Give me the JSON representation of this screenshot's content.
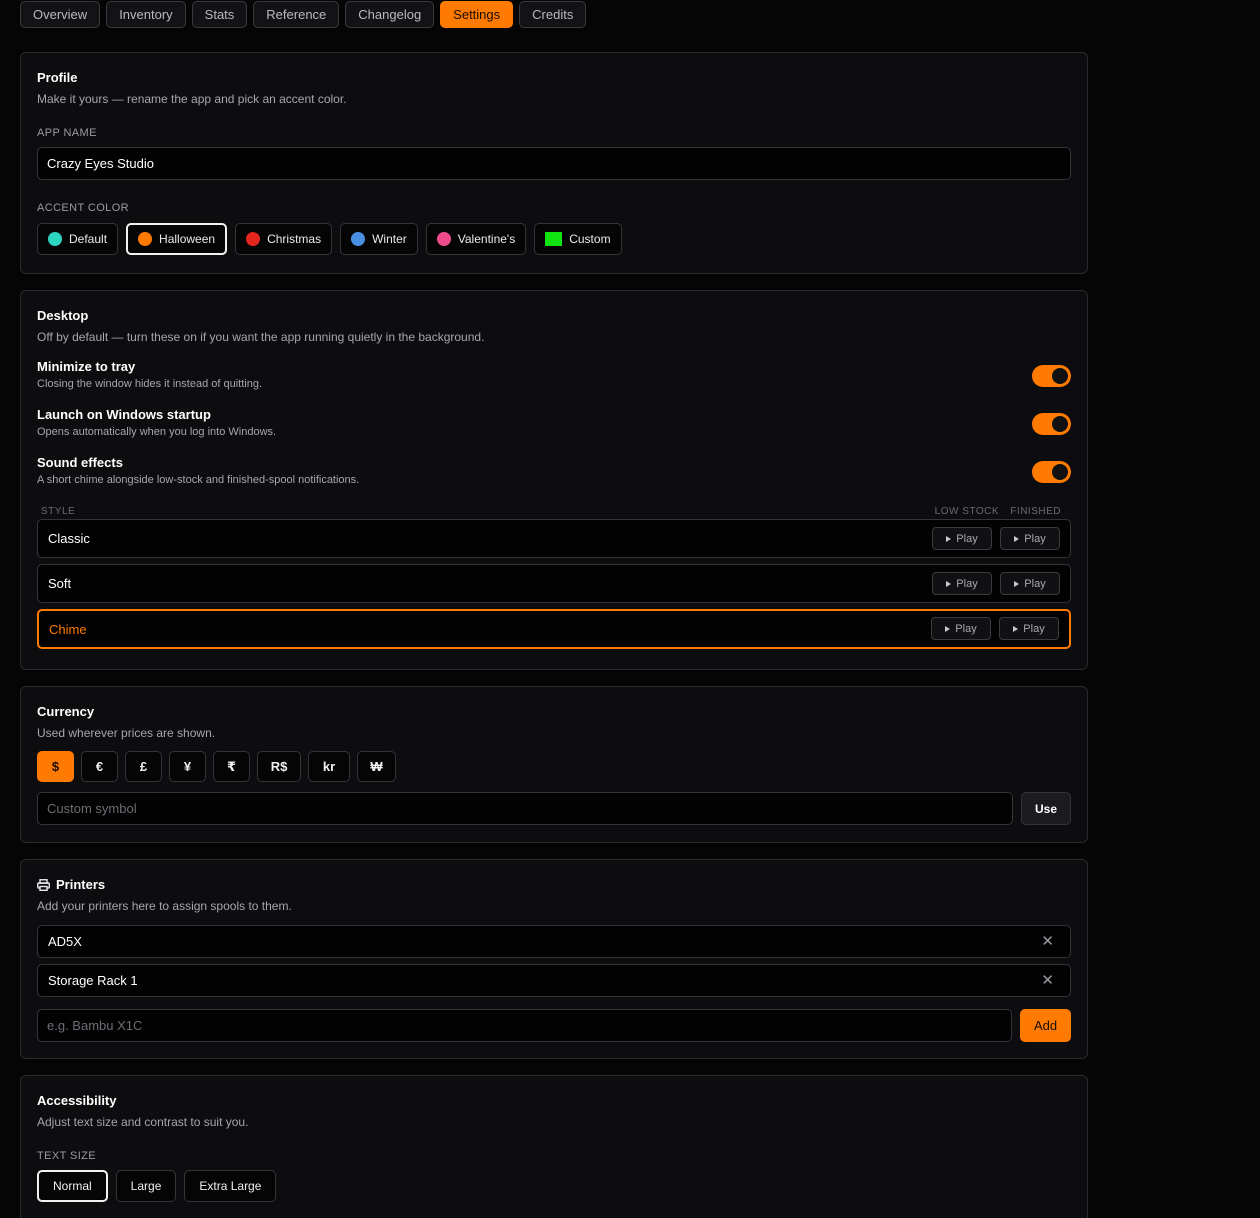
{
  "tabs": [
    "Overview",
    "Inventory",
    "Stats",
    "Reference",
    "Changelog",
    "Settings",
    "Credits"
  ],
  "active_tab": "Settings",
  "accent": "#ff7a00",
  "profile": {
    "title": "Profile",
    "subtitle": "Make it yours — rename the app and pick an accent color.",
    "app_name_label": "APP NAME",
    "app_name_value": "Crazy Eyes Studio",
    "accent_label": "ACCENT COLOR",
    "accent_options": [
      {
        "label": "Default",
        "color": "#2dd4bf"
      },
      {
        "label": "Halloween",
        "color": "#ff7a00",
        "selected": true
      },
      {
        "label": "Christmas",
        "color": "#e5261f"
      },
      {
        "label": "Winter",
        "color": "#4a90e2"
      },
      {
        "label": "Valentine's",
        "color": "#ee4b8a"
      },
      {
        "label": "Custom",
        "color": "#11e311"
      }
    ]
  },
  "desktop": {
    "title": "Desktop",
    "subtitle": "Off by default — turn these on if you want the app running quietly in the background.",
    "toggles": [
      {
        "title": "Minimize to tray",
        "desc": "Closing the window hides it instead of quitting.",
        "on": true
      },
      {
        "title": "Launch on Windows startup",
        "desc": "Opens automatically when you log into Windows.",
        "on": true
      },
      {
        "title": "Sound effects",
        "desc": "A short chime alongside low-stock and finished-spool notifications.",
        "on": true
      }
    ],
    "style_header": "STYLE",
    "low_stock_header": "LOW STOCK",
    "finished_header": "FINISHED",
    "play_label": "Play",
    "styles": [
      "Classic",
      "Soft",
      "Chime"
    ],
    "active_style": "Chime"
  },
  "currency": {
    "title": "Currency",
    "subtitle": "Used wherever prices are shown.",
    "symbols": [
      "$",
      "€",
      "£",
      "¥",
      "₹",
      "R$",
      "kr",
      "₩"
    ],
    "active_symbol": "$",
    "custom_placeholder": "Custom symbol",
    "use_label": "Use"
  },
  "printers": {
    "title": "Printers",
    "icon": "printer-icon",
    "subtitle": "Add your printers here to assign spools to them.",
    "items": [
      "AD5X",
      "Storage Rack 1"
    ],
    "remove_glyph": "✕",
    "add_placeholder": "e.g. Bambu X1C",
    "add_label": "Add"
  },
  "accessibility": {
    "title": "Accessibility",
    "subtitle": "Adjust text size and contrast to suit you.",
    "text_size_label": "TEXT SIZE",
    "sizes": [
      "Normal",
      "Large",
      "Extra Large"
    ],
    "selected_size": "Normal"
  }
}
